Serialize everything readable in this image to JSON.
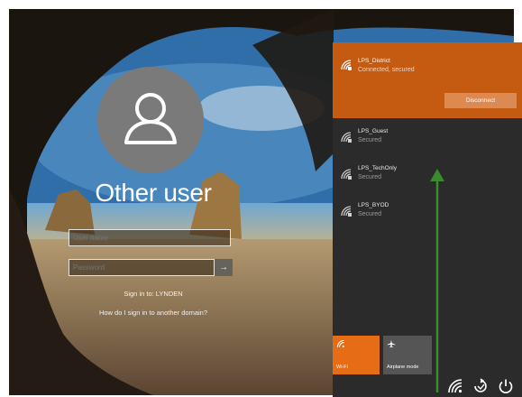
{
  "login": {
    "account_name": "Other user",
    "username_placeholder": "User name",
    "password_placeholder": "Password",
    "submit_glyph": "→",
    "sign_in_to": "Sign in to: LYNDEN",
    "domain_help_link": "How do I sign in to another domain?"
  },
  "network_flyout": {
    "connected": {
      "ssid": "LPS_District",
      "status": "Connected, secured",
      "disconnect_label": "Disconnect"
    },
    "networks": [
      {
        "ssid": "LPS_Guest",
        "status": "Secured"
      },
      {
        "ssid": "LPS_TechOnly",
        "status": "Secured"
      },
      {
        "ssid": "LPS_BYOD",
        "status": "Secured"
      }
    ],
    "tiles": {
      "wifi_label": "Wi-Fi",
      "airplane_label": "Airplane mode"
    }
  },
  "tray_icons": [
    "wifi-icon",
    "ease-of-access-icon",
    "power-icon"
  ],
  "colors": {
    "accent_orange": "#c55a11",
    "flyout_bg": "#2b2b2b",
    "arrow_green": "#3a8a2e"
  }
}
